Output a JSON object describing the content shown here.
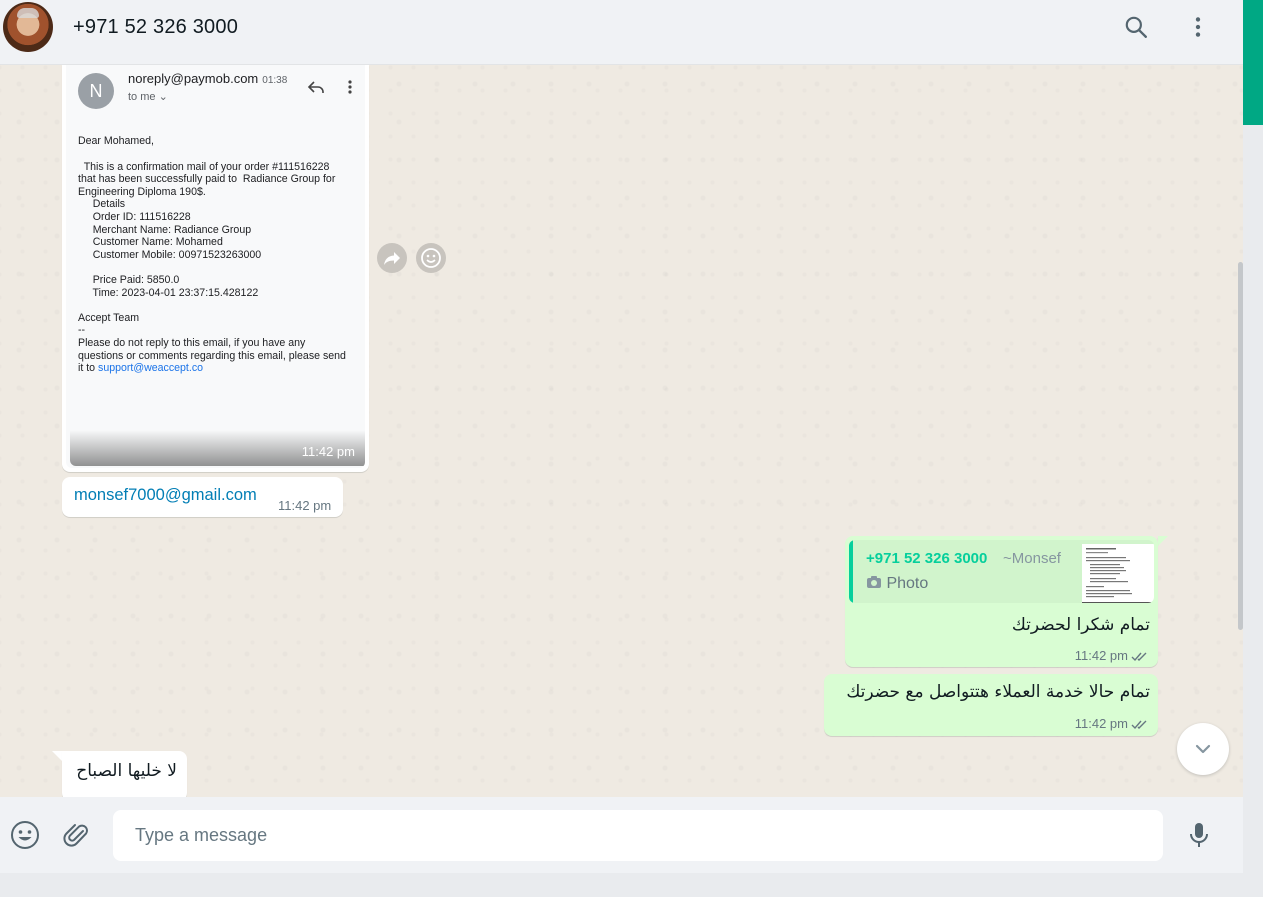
{
  "header": {
    "contact_name": "+971 52 326 3000",
    "icons": [
      "search-icon",
      "menu-icon"
    ]
  },
  "colors": {
    "accent": "#00a884",
    "outgoing_bubble": "#d9fdd3",
    "incoming_bubble": "#ffffff",
    "chat_bg": "#efeae2",
    "quote_name": "#06cf9c"
  },
  "email_image": {
    "avatar_letter": "N",
    "from": "noreply@paymob.com",
    "time": "01:38",
    "to": "to me",
    "greeting": "Dear Mohamed,",
    "body_lines": [
      "  This is a confirmation mail of your order #111516228",
      "that has been successfully paid to  Radiance Group for",
      "Engineering Diploma 190$.",
      "     Details",
      "     Order ID: 111516228",
      "     Merchant Name: Radiance Group",
      "     Customer Name: Mohamed",
      "     Customer Mobile: 00971523263000",
      "",
      "     Price Paid: 5850.0",
      "     Time: 2023-04-01 23:37:15.428122",
      "",
      "Accept Team",
      "--",
      "Please do not reply to this email, if you have any",
      "questions or comments regarding this email, please send"
    ],
    "last_line_prefix": "it to ",
    "support_link": "support@weaccept.co",
    "message_time": "11:42 pm"
  },
  "messages": {
    "email_text": "monsef7000@gmail.com",
    "email_time": "11:42 pm",
    "reply_quote_phone": "+971 52 326 3000",
    "reply_quote_pushname": "~Monsef",
    "reply_quote_type": "Photo",
    "reply_text": "تمام شكرا لحضرتك",
    "reply_time": "11:42 pm",
    "second_text": "تمام حالا خدمة العملاء هتتواصل مع حضرتك",
    "second_time": "11:42 pm",
    "incoming_text": "لا خليها الصباح"
  },
  "composer": {
    "placeholder": "Type a message",
    "icons": [
      "emoji-icon",
      "attach-icon",
      "mic-icon"
    ]
  }
}
